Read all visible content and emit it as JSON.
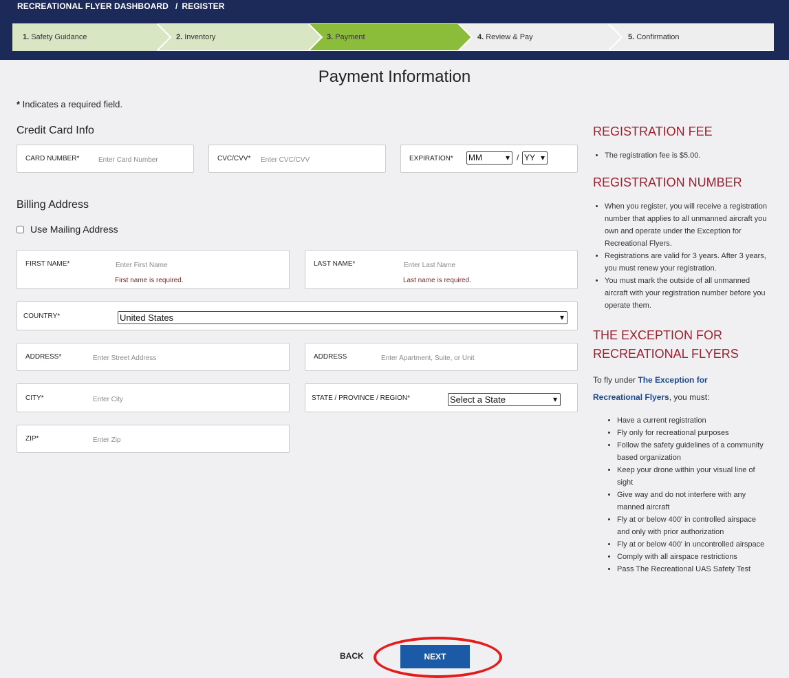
{
  "breadcrumb": {
    "home": "RECREATIONAL FLYER DASHBOARD",
    "separator": "/",
    "current": "REGISTER"
  },
  "steps": [
    {
      "num": "1.",
      "label": "Safety Guidance"
    },
    {
      "num": "2.",
      "label": "Inventory"
    },
    {
      "num": "3.",
      "label": "Payment"
    },
    {
      "num": "4.",
      "label": "Review & Pay"
    },
    {
      "num": "5.",
      "label": "Confirmation"
    }
  ],
  "colors": {
    "header": "#1c2a5a",
    "step_done": "#d9e6c3",
    "step_active": "#8cbd3a",
    "step_todo": "#eeeeef",
    "accent_red": "#9d2230",
    "next_button": "#1a5aa6",
    "annotation": "#e31c1c"
  },
  "page_title": "Payment Information",
  "required_note": {
    "star": "*",
    "text": " Indicates a required field."
  },
  "credit_card": {
    "heading": "Credit Card Info",
    "card_number": {
      "label": "CARD NUMBER*",
      "placeholder": "Enter Card Number"
    },
    "cvc": {
      "label": "CVC/CVV*",
      "placeholder": "Enter CVC/CVV"
    },
    "expiration": {
      "label": "EXPIRATION*",
      "month": "MM",
      "slash": "/",
      "year": "YY"
    }
  },
  "billing": {
    "heading": "Billing Address",
    "use_mailing": "Use Mailing Address",
    "first_name": {
      "label": "FIRST NAME*",
      "placeholder": "Enter First Name",
      "error": "First name is required."
    },
    "last_name": {
      "label": "LAST NAME*",
      "placeholder": "Enter Last Name",
      "error": "Last name is required."
    },
    "country": {
      "label": "COUNTRY*",
      "value": "United States"
    },
    "address1": {
      "label": "ADDRESS*",
      "placeholder": "Enter Street Address"
    },
    "address2": {
      "label": "ADDRESS",
      "placeholder": "Enter Apartment, Suite, or Unit"
    },
    "city": {
      "label": "CITY*",
      "placeholder": "Enter City"
    },
    "state": {
      "label": "STATE / PROVINCE / REGION*",
      "value": "Select a State"
    },
    "zip": {
      "label": "ZIP*",
      "placeholder": "Enter Zip"
    }
  },
  "sidebar": {
    "fee_heading": "REGISTRATION FEE",
    "fee_items": [
      "The registration fee is $5.00."
    ],
    "number_heading": "REGISTRATION NUMBER",
    "number_items": [
      "When you register, you will receive a registration number that applies to all unmanned aircraft you own and operate under the Exception for Recreational Flyers.",
      "Registrations are valid for 3 years. After 3 years, you must renew your registration.",
      "You must mark the outside of all unmanned aircraft with your registration number before you operate them."
    ],
    "exception_heading_1": "THE EXCEPTION FOR",
    "exception_heading_2": "RECREATIONAL FLYERS",
    "intro_before": "To fly under ",
    "intro_link": "The Exception for Recreational Flyers",
    "intro_after": ", you must:",
    "rules": [
      "Have a current registration",
      "Fly only for recreational purposes",
      "Follow the safety guidelines of a community based organization",
      "Keep your drone within your visual line of sight",
      "Give way and do not interfere with any manned aircraft",
      "Fly at or below 400' in controlled airspace and only with prior authorization",
      "Fly at or below 400' in uncontrolled airspace",
      "Comply with all airspace restrictions",
      "Pass The Recreational UAS Safety Test"
    ]
  },
  "buttons": {
    "back": "BACK",
    "next": "NEXT"
  }
}
